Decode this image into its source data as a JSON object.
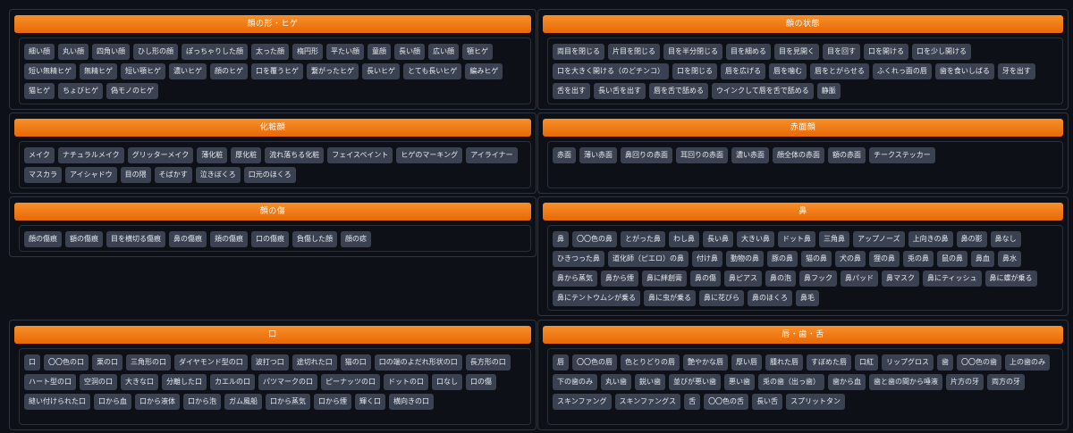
{
  "sections": [
    {
      "title": "顔の形・ヒゲ",
      "tags": [
        "細い顔",
        "丸い顔",
        "四角い顔",
        "ひし形の顔",
        "ぽっちゃりした顔",
        "太った顔",
        "楕円形",
        "平たい顔",
        "童顔",
        "長い顔",
        "広い顔",
        "顎ヒゲ",
        "短い無精ヒゲ",
        "無精ヒゲ",
        "短い顎ヒゲ",
        "濃いヒゲ",
        "顔のヒゲ",
        "口を覆うヒゲ",
        "繋がったヒゲ",
        "長いヒゲ",
        "とても長いヒゲ",
        "編みヒゲ",
        "猫ヒゲ",
        "ちょびヒゲ",
        "偽モノのヒゲ"
      ]
    },
    {
      "title": "顔の状態",
      "tags": [
        "両目を閉じる",
        "片目を閉じる",
        "目を半分閉じる",
        "目を細める",
        "目を見開く",
        "目を回す",
        "口を開ける",
        "口を少し開ける",
        "口を大きく開ける（のどチンコ）",
        "口を閉じる",
        "唇を広げる",
        "唇を噛む",
        "唇をとがらせる",
        "ふくれっ面の唇",
        "歯を食いしばる",
        "牙を出す",
        "舌を出す",
        "長い舌を出す",
        "唇を舌で舐める",
        "ウインクして唇を舌で舐める",
        "静脈"
      ]
    },
    {
      "title": "化粧顔",
      "tags": [
        "メイク",
        "ナチュラルメイク",
        "グリッターメイク",
        "薄化粧",
        "厚化粧",
        "流れ落ちる化粧",
        "フェイスペイント",
        "ヒゲのマーキング",
        "アイライナー",
        "マスカラ",
        "アイシャドウ",
        "目の隈",
        "そばかす",
        "泣きぼくろ",
        "口元のほくろ"
      ]
    },
    {
      "title": "赤面顔",
      "tags": [
        "赤面",
        "薄い赤面",
        "鼻回りの赤面",
        "耳回りの赤面",
        "濃い赤面",
        "顔全体の赤面",
        "額の赤面",
        "チークステッカー"
      ]
    },
    {
      "title": "顔の傷",
      "tags": [
        "顔の傷痕",
        "額の傷痕",
        "目を横切る傷痕",
        "鼻の傷痕",
        "頬の傷痕",
        "口の傷痕",
        "負傷した顔",
        "顔の痣"
      ]
    },
    {
      "title": "鼻",
      "tags": [
        "鼻",
        "〇〇色の鼻",
        "とがった鼻",
        "わし鼻",
        "長い鼻",
        "大きい鼻",
        "ドット鼻",
        "三角鼻",
        "アップノーズ",
        "上向きの鼻",
        "鼻の影",
        "鼻なし",
        "ひきつった鼻",
        "道化師（ピエロ）の鼻",
        "付け鼻",
        "動物の鼻",
        "豚の鼻",
        "猫の鼻",
        "犬の鼻",
        "狸の鼻",
        "兎の鼻",
        "鼠の鼻",
        "鼻血",
        "鼻水",
        "鼻から蒸気",
        "鼻から煙",
        "鼻に絆創膏",
        "鼻の傷",
        "鼻ピアス",
        "鼻の泡",
        "鼻フック",
        "鼻パッド",
        "鼻マスク",
        "鼻にティッシュ",
        "鼻に蝶が乗る",
        "鼻にテントウムシが乗る",
        "鼻に虫が乗る",
        "鼻に花びら",
        "鼻のほくろ",
        "鼻毛"
      ]
    },
    {
      "title": "口",
      "tags": [
        "口",
        "〇〇色の口",
        "栗の口",
        "三角形の口",
        "ダイヤモンド型の口",
        "波打つ口",
        "途切れた口",
        "猫の口",
        "口の端のよだれ形状の口",
        "長方形の口",
        "ハート型の口",
        "空洞の口",
        "大きな口",
        "分離した口",
        "カエルの口",
        "パツマークの口",
        "ピーナッツの口",
        "ドットの口",
        "口なし",
        "口の傷",
        "縫い付けられた口",
        "口から血",
        "口から液体",
        "口から泡",
        "ガム風船",
        "口から蒸気",
        "口から煙",
        "輝く口",
        "横向きの口"
      ]
    },
    {
      "title": "唇・歯・舌",
      "tags": [
        "唇",
        "〇〇色の唇",
        "色とりどりの唇",
        "艶やかな唇",
        "厚い唇",
        "腫れた唇",
        "すぼめた唇",
        "口紅",
        "リップグロス",
        "歯",
        "〇〇色の歯",
        "上の歯のみ",
        "下の歯のみ",
        "丸い歯",
        "鋭い歯",
        "並びが悪い歯",
        "悪い歯",
        "兎の歯（出っ歯）",
        "歯から血",
        "歯と歯の間から唾液",
        "片方の牙",
        "両方の牙",
        "スキンファング",
        "スキンファングス",
        "舌",
        "〇〇色の舌",
        "長い舌",
        "スプリットタン"
      ]
    }
  ]
}
